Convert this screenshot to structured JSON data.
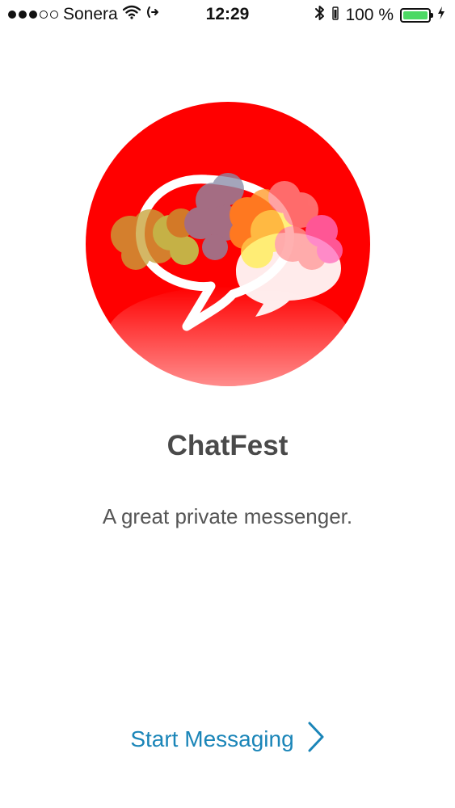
{
  "status_bar": {
    "carrier": "Sonera",
    "time": "12:29",
    "battery_percent": "100 %",
    "battery_level": 1.0,
    "signal_bars_filled": 3,
    "signal_bars_total": 5
  },
  "app": {
    "name": "ChatFest",
    "tagline": "A great private messenger."
  },
  "actions": {
    "start_label": "Start Messaging"
  },
  "colors": {
    "logo_red": "#ff0000",
    "link_blue": "#1a85b8",
    "title_gray": "#4a4a4a",
    "battery_green": "#4cd964"
  },
  "icons": {
    "wifi": "wifi-icon",
    "location": "location-arrow-icon",
    "bluetooth": "bluetooth-icon",
    "charging": "charging-bolt-icon",
    "chevron": "chevron-right-icon"
  }
}
